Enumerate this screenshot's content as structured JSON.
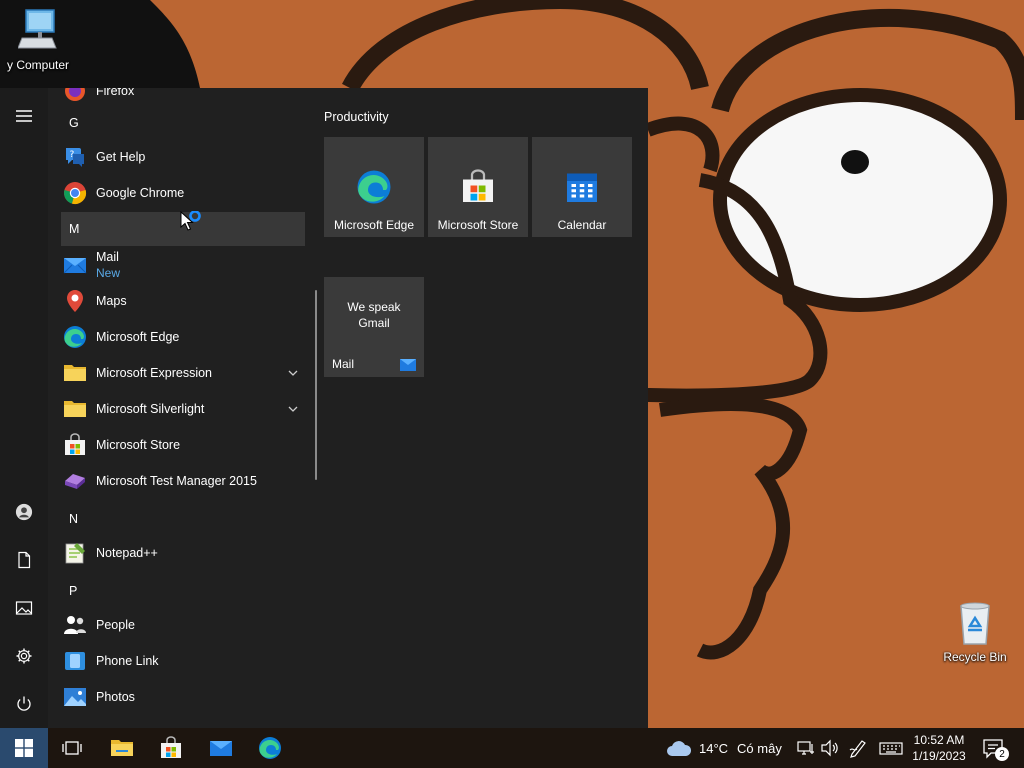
{
  "desktop": {
    "icons": [
      {
        "label": "y Computer",
        "icon": "computer-icon"
      },
      {
        "label": "Recycle Bin",
        "icon": "recycle-bin-icon"
      }
    ]
  },
  "start_menu": {
    "rail": [
      "menu-icon",
      "user-icon",
      "documents-icon",
      "pictures-icon",
      "settings-icon",
      "power-icon"
    ],
    "app_list": [
      {
        "type": "app",
        "label": "Firefox",
        "icon": "firefox-icon"
      },
      {
        "type": "letter",
        "label": "G"
      },
      {
        "type": "app",
        "label": "Get Help",
        "icon": "get-help-icon"
      },
      {
        "type": "app",
        "label": "Google Chrome",
        "icon": "chrome-icon"
      },
      {
        "type": "letter",
        "label": "M"
      },
      {
        "type": "app",
        "label": "Mail",
        "sub": "New",
        "icon": "mail-icon"
      },
      {
        "type": "app",
        "label": "Maps",
        "icon": "maps-icon"
      },
      {
        "type": "app",
        "label": "Microsoft Edge",
        "icon": "edge-icon"
      },
      {
        "type": "folder",
        "label": "Microsoft Expression",
        "icon": "folder-icon"
      },
      {
        "type": "folder",
        "label": "Microsoft Silverlight",
        "icon": "folder-icon"
      },
      {
        "type": "app",
        "label": "Microsoft Store",
        "icon": "store-icon"
      },
      {
        "type": "app",
        "label": "Microsoft Test Manager 2015",
        "icon": "test-manager-icon"
      },
      {
        "type": "letter",
        "label": "N"
      },
      {
        "type": "app",
        "label": "Notepad++",
        "icon": "notepad-plus-icon"
      },
      {
        "type": "letter",
        "label": "P"
      },
      {
        "type": "app",
        "label": "People",
        "icon": "people-icon"
      },
      {
        "type": "app",
        "label": "Phone Link",
        "icon": "phone-link-icon"
      },
      {
        "type": "app",
        "label": "Photos",
        "icon": "photos-icon"
      }
    ],
    "tiles": {
      "group_title": "Productivity",
      "edge": "Microsoft Edge",
      "store": "Microsoft Store",
      "calendar": "Calendar",
      "mail_message": "We speak Gmail",
      "mail": "Mail"
    }
  },
  "taskbar": {
    "pinned": [
      "windows-start-icon",
      "task-view-icon",
      "file-explorer-icon",
      "store-icon",
      "mail-icon",
      "edge-icon"
    ],
    "weather": {
      "temp": "14°C",
      "condition": "Có mây"
    },
    "clock": {
      "time": "10:52 AM",
      "date": "1/19/2023"
    },
    "notifications": "2"
  },
  "colors": {
    "menu_bg": "#202020",
    "tile_bg": "#3a3a3a",
    "accent": "#5aa9e6",
    "taskbar_bg": "#1d150f"
  }
}
